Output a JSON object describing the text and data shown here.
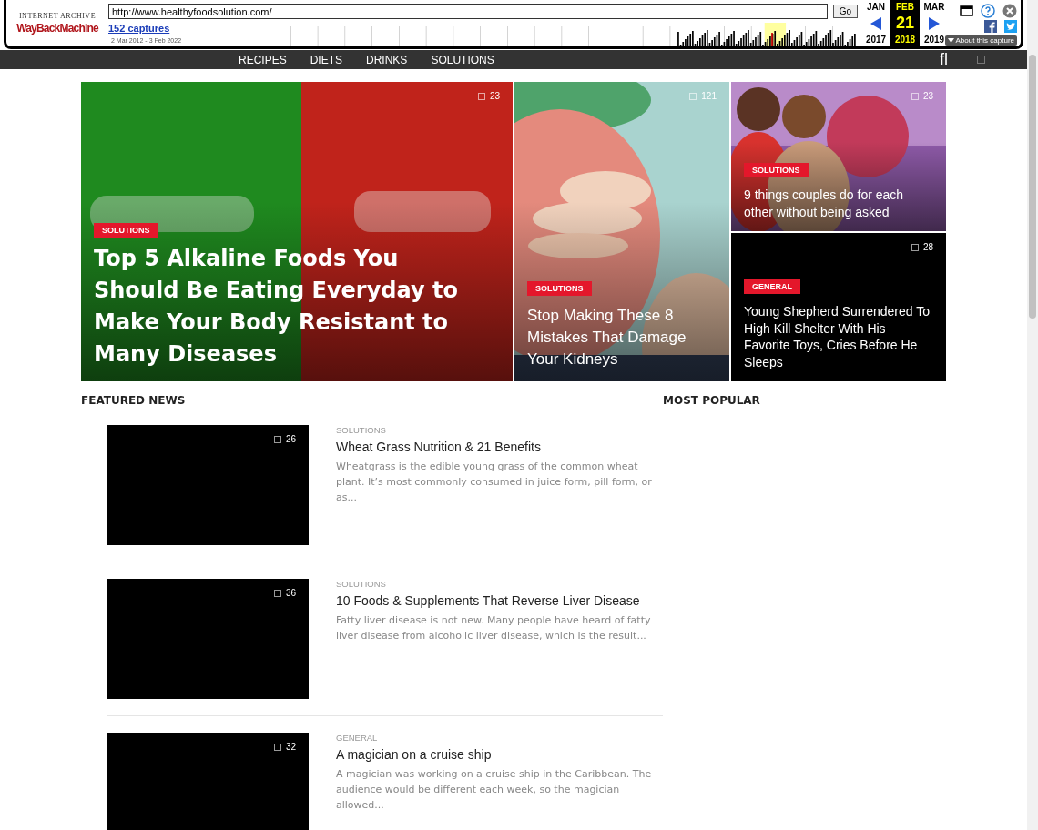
{
  "wayback": {
    "logo_top": "INTERNET ARCHIVE",
    "logo": "WayBackMachine",
    "url": "http://www.healthyfoodsolution.com/",
    "go": "Go",
    "captures": "152 captures",
    "range": "2 Mar 2012 - 3 Feb 2022",
    "months": [
      {
        "month": "JAN",
        "year": "2017",
        "selected": false
      },
      {
        "month": "FEB",
        "day": "21",
        "year": "2018",
        "selected": true
      },
      {
        "month": "MAR",
        "year": "2019",
        "selected": false
      }
    ],
    "about": "About this capture"
  },
  "nav": {
    "items": [
      "RECIPES",
      "DIETS",
      "DRINKS",
      "SOLUTIONS"
    ],
    "search_glyph": "fl"
  },
  "hero": [
    {
      "kind": "picture",
      "category": "SOLUTIONS",
      "title": "Top 5 Alkaline Foods You Should Be Eating Everyday to Make Your Body Resistant to Many Diseases",
      "comments": "23"
    },
    {
      "kind": "picture",
      "category": "SOLUTIONS",
      "title": "Stop Making These 8 Mistakes That Damage Your Kidneys",
      "comments": "121"
    },
    {
      "kind": "picture",
      "category": "SOLUTIONS",
      "title": "9 things couples do for each other without being asked",
      "comments": "23"
    },
    {
      "kind": "blank",
      "category": "GENERAL",
      "title": "Young Shepherd Surrendered To High Kill Shelter With His Favorite Toys, Cries Before He Sleeps",
      "comments": "28"
    }
  ],
  "featured_title": "FEATURED NEWS",
  "popular_title": "MOST POPULAR",
  "featured": [
    {
      "category": "SOLUTIONS",
      "title": "Wheat Grass Nutrition & 21 Benefits",
      "excerpt": "Wheatgrass is the edible young grass of the common wheat plant. It’s most commonly consumed in juice form, pill form, or as...",
      "comments": "26"
    },
    {
      "category": "SOLUTIONS",
      "title": "10 Foods & Supplements That Reverse Liver Disease",
      "excerpt": "Fatty liver disease is not new.  Many people have heard of fatty liver disease from alcoholic liver disease, which is the result...",
      "comments": "36"
    },
    {
      "category": "GENERAL",
      "title": "A magician on a cruise ship",
      "excerpt": "A magician was working on a cruise ship in the Caribbean. The audience would be different each week, so the magician allowed...",
      "comments": "32"
    }
  ]
}
